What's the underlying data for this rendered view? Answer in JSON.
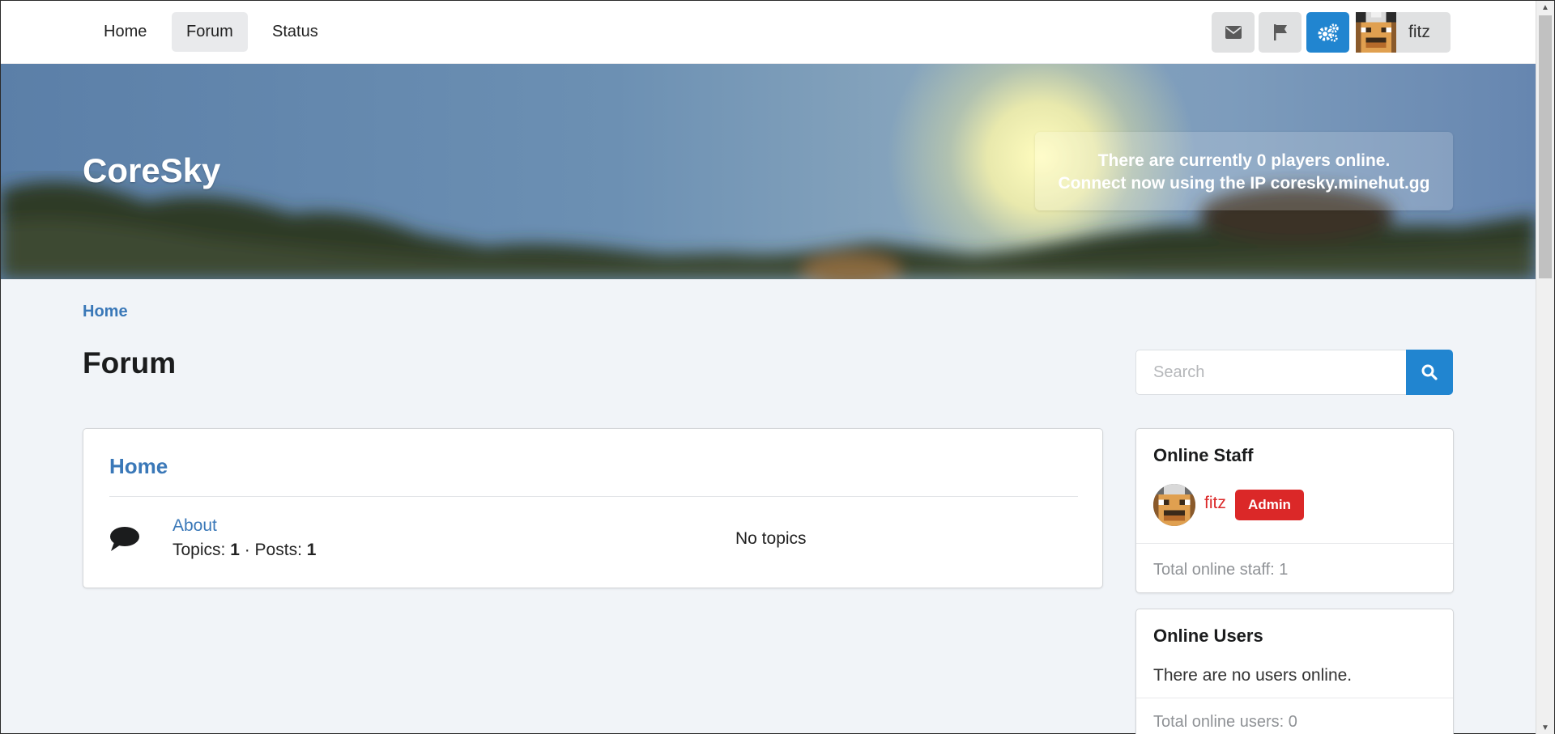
{
  "nav": {
    "items": [
      {
        "label": "Home"
      },
      {
        "label": "Forum"
      },
      {
        "label": "Status"
      }
    ],
    "user_name": "fitz",
    "icons": [
      "envelope-icon",
      "flag-icon",
      "cogs-icon"
    ]
  },
  "banner": {
    "title": "CoreSky",
    "status_line1": "There are currently 0 players online.",
    "status_line2": "Connect now using the IP coresky.minehut.gg"
  },
  "breadcrumb": "Home",
  "page_title": "Forum",
  "search": {
    "placeholder": "Search"
  },
  "forum": {
    "category": "Home",
    "subforum": {
      "name": "About",
      "topics_label": "Topics: ",
      "topics": "1",
      "posts_label": " · Posts: ",
      "posts": "1",
      "latest": "No topics"
    }
  },
  "staff": {
    "title": "Online Staff",
    "members": [
      {
        "name": "fitz",
        "badge": "Admin"
      }
    ],
    "total": "Total online staff: 1"
  },
  "users": {
    "title": "Online Users",
    "empty": "There are no users online.",
    "total": "Total online users: 0"
  },
  "colors": {
    "primary": "#2185d0",
    "link": "#3a78b8",
    "admin": "#db2828",
    "background": "#f1f4f8"
  }
}
